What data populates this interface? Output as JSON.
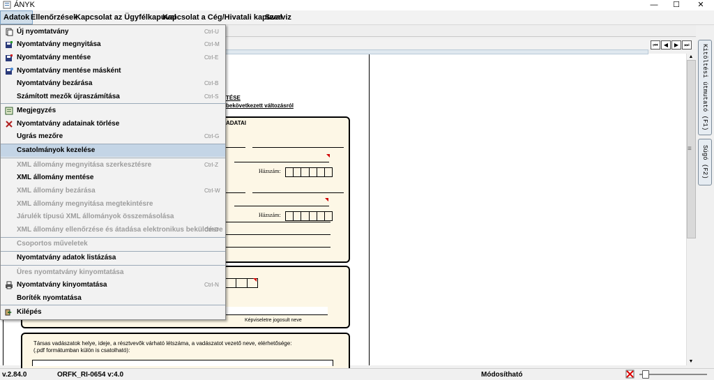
{
  "window": {
    "title": "ÁNYK"
  },
  "menubar": {
    "items": [
      "Adatok",
      "Ellenőrzések",
      "Kapcsolat az Ügyfélkapuval",
      "Kapcsolat a Cég/Hivatali kapuval",
      "Szerviz"
    ]
  },
  "dropdown": {
    "items": [
      {
        "label": "Új nyomtatvány",
        "shortcut": "Ctrl-U",
        "icon": "new-form-icon",
        "disabled": false
      },
      {
        "label": "Nyomtatvány megnyitása",
        "shortcut": "Ctrl-M",
        "icon": "open-form-icon",
        "disabled": false
      },
      {
        "label": "Nyomtatvány mentése",
        "shortcut": "Ctrl-E",
        "icon": "save-icon",
        "disabled": false
      },
      {
        "label": "Nyomtatvány mentése másként",
        "shortcut": "",
        "icon": "save-as-icon",
        "disabled": false
      },
      {
        "label": "Nyomtatvány bezárása",
        "shortcut": "Ctrl-B",
        "icon": "",
        "disabled": false
      },
      {
        "label": "Számított mezők újraszámítása",
        "shortcut": "Ctrl-S",
        "icon": "",
        "disabled": false
      },
      {
        "label": "Megjegyzés",
        "shortcut": "",
        "icon": "note-icon",
        "disabled": false
      },
      {
        "label": "Nyomtatvány adatainak törlése",
        "shortcut": "",
        "icon": "delete-x-icon",
        "disabled": false
      },
      {
        "label": "Ugrás mezőre",
        "shortcut": "Ctrl-G",
        "icon": "",
        "disabled": false
      },
      {
        "label": "Csatolmányok kezelése",
        "shortcut": "",
        "icon": "",
        "disabled": false
      },
      {
        "label": "XML állomány megnyitása szerkesztésre",
        "shortcut": "Ctrl-Z",
        "icon": "",
        "disabled": true
      },
      {
        "label": "XML állomány mentése",
        "shortcut": "",
        "icon": "",
        "disabled": false
      },
      {
        "label": "XML állomány bezárása",
        "shortcut": "Ctrl-W",
        "icon": "",
        "disabled": true
      },
      {
        "label": "XML állomány megnyitása megtekintésre",
        "shortcut": "",
        "icon": "",
        "disabled": true
      },
      {
        "label": "Járulék típusú XML állományok összemásolása",
        "shortcut": "",
        "icon": "",
        "disabled": true
      },
      {
        "label": "XML állomány ellenőrzése és átadása elektronikus beküldésre",
        "shortcut": "Ctrl-D",
        "icon": "",
        "disabled": true
      },
      {
        "label": "Csoportos műveletek",
        "shortcut": "",
        "icon": "",
        "disabled": true
      },
      {
        "label": "Nyomtatvány adatok listázása",
        "shortcut": "",
        "icon": "",
        "disabled": false
      },
      {
        "label": "Üres nyomtatvány kinyomtatása",
        "shortcut": "",
        "icon": "",
        "disabled": true
      },
      {
        "label": "Nyomtatvány kinyomtatása",
        "shortcut": "Ctrl-N",
        "icon": "printer-icon",
        "disabled": false
      },
      {
        "label": "Boríték nyomtatása",
        "shortcut": "",
        "icon": "",
        "disabled": false
      },
      {
        "label": "Kilépés",
        "shortcut": "",
        "icon": "exit-icon",
        "disabled": false
      }
    ]
  },
  "document": {
    "title_line1": "TÉSE",
    "title_line2": "bekövetkezett változásról",
    "section1_header": "ADATAI",
    "house_number_label": "Házszám:",
    "representative_label": "Képviseletre jogosult neve",
    "hunting_text_line1": "Társas vadászatok helye, ideje, a résztvevők várható létszáma, a vadászatot vezető neve, elérhetősége:",
    "hunting_text_line2": "(.pdf formátumban külön is csatolható):"
  },
  "side_tabs": {
    "guide": "Kitöltési útmutató (F1)",
    "help": "Súgó (F2)"
  },
  "status": {
    "version": "v.2.84.0",
    "form_id": "ORFK_RI-0654 v:4.0",
    "mode": "Módosítható"
  }
}
